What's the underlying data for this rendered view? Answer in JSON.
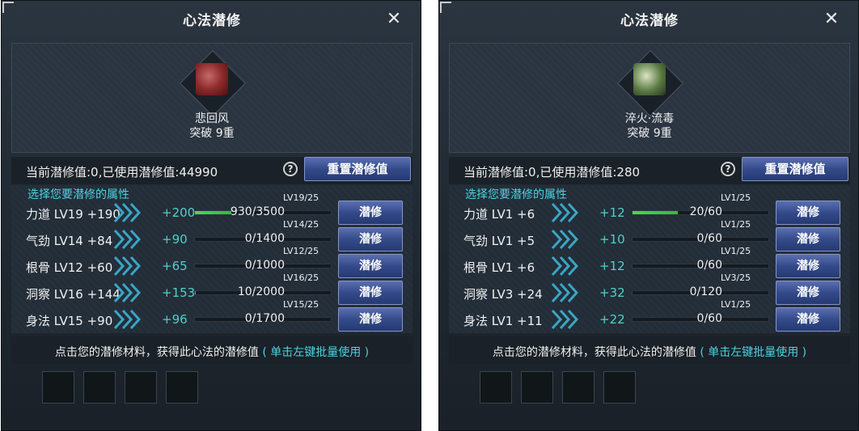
{
  "panels": [
    {
      "title": "心法潜修",
      "close": "✕",
      "skill": {
        "name": "悲回风",
        "breakthrough": "突破 9重",
        "icon": "red-book-icon"
      },
      "current_value": "当前潜修值:0,已使用潜修值:44990",
      "help": "?",
      "reset_label": "重置潜修值",
      "prompt": "选择您要潜修的属性",
      "rows": [
        {
          "attr": "力道 LV19 +190",
          "plus": "+200",
          "progress": "930/3500",
          "fraction": 0.2657,
          "level": "LV19/25",
          "button": "潜修"
        },
        {
          "attr": "气劲 LV14 +84",
          "plus": "+90",
          "progress": "0/1400",
          "fraction": 0,
          "level": "LV14/25",
          "button": "潜修"
        },
        {
          "attr": "根骨 LV12 +60",
          "plus": "+65",
          "progress": "0/1000",
          "fraction": 0,
          "level": "LV12/25",
          "button": "潜修"
        },
        {
          "attr": "洞察 LV16 +144",
          "plus": "+153",
          "progress": "10/2000",
          "fraction": 0.005,
          "level": "LV16/25",
          "button": "潜修"
        },
        {
          "attr": "身法 LV15 +90",
          "plus": "+96",
          "progress": "0/1700",
          "fraction": 0,
          "level": "LV15/25",
          "button": "潜修"
        }
      ],
      "footer_text": "点击您的潜修材料，获得此心法的潜修值",
      "footer_link": "( 单击左键批量使用 )"
    },
    {
      "title": "心法潜修",
      "close": "✕",
      "skill": {
        "name": "淬火·流毒",
        "breakthrough": "突破 9重",
        "icon": "green-scroll-icon"
      },
      "current_value": "当前潜修值:0,已使用潜修值:280",
      "help": "?",
      "reset_label": "重置潜修值",
      "prompt": "选择您要潜修的属性",
      "rows": [
        {
          "attr": "力道 LV1 +6",
          "plus": "+12",
          "progress": "20/60",
          "fraction": 0.3333,
          "level": "LV1/25",
          "button": "潜修"
        },
        {
          "attr": "气劲 LV1 +5",
          "plus": "+10",
          "progress": "0/60",
          "fraction": 0,
          "level": "LV1/25",
          "button": "潜修"
        },
        {
          "attr": "根骨 LV1 +6",
          "plus": "+12",
          "progress": "0/60",
          "fraction": 0,
          "level": "LV1/25",
          "button": "潜修"
        },
        {
          "attr": "洞察 LV3 +24",
          "plus": "+32",
          "progress": "0/120",
          "fraction": 0,
          "level": "LV3/25",
          "button": "潜修"
        },
        {
          "attr": "身法 LV1 +11",
          "plus": "+22",
          "progress": "0/60",
          "fraction": 0,
          "level": "LV1/25",
          "button": "潜修"
        }
      ],
      "footer_text": "点击您的潜修材料，获得此心法的潜修值",
      "footer_link": "( 单击左键批量使用 )"
    }
  ]
}
